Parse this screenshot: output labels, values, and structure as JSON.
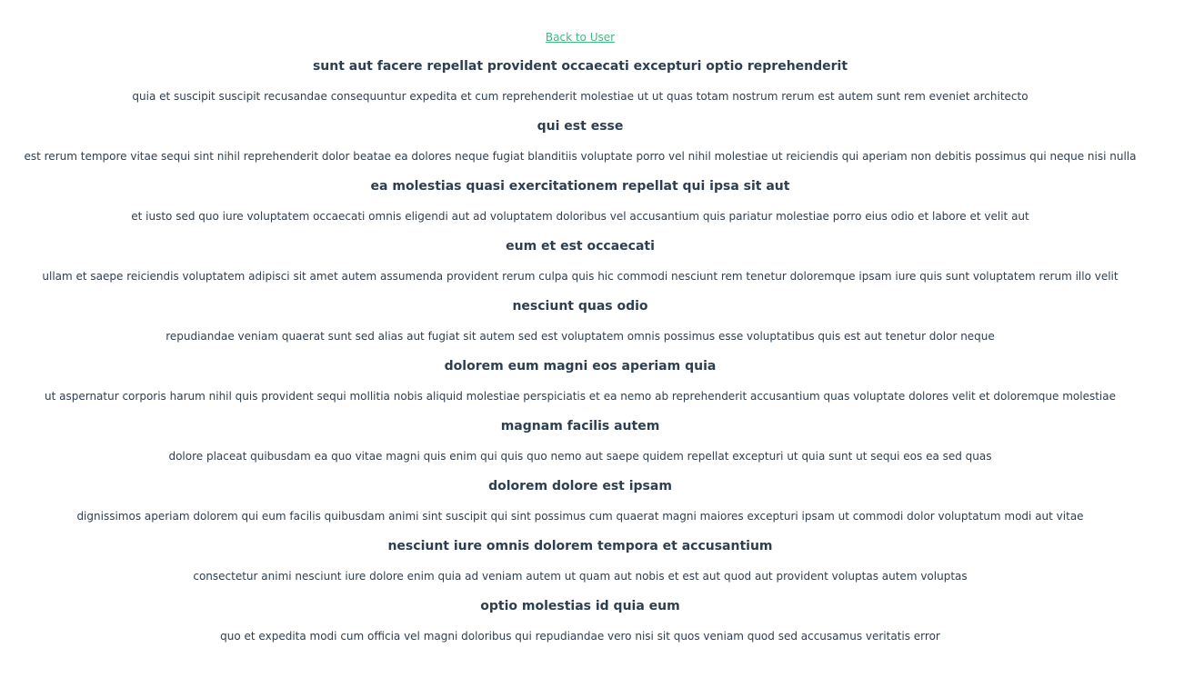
{
  "nav": {
    "back_label": "Back to User"
  },
  "posts": [
    {
      "title": "sunt aut facere repellat provident occaecati excepturi optio reprehenderit",
      "body": "quia et suscipit suscipit recusandae consequuntur expedita et cum reprehenderit molestiae ut ut quas totam nostrum rerum est autem sunt rem eveniet architecto"
    },
    {
      "title": "qui est esse",
      "body": "est rerum tempore vitae sequi sint nihil reprehenderit dolor beatae ea dolores neque fugiat blanditiis voluptate porro vel nihil molestiae ut reiciendis qui aperiam non debitis possimus qui neque nisi nulla"
    },
    {
      "title": "ea molestias quasi exercitationem repellat qui ipsa sit aut",
      "body": "et iusto sed quo iure voluptatem occaecati omnis eligendi aut ad voluptatem doloribus vel accusantium quis pariatur molestiae porro eius odio et labore et velit aut"
    },
    {
      "title": "eum et est occaecati",
      "body": "ullam et saepe reiciendis voluptatem adipisci sit amet autem assumenda provident rerum culpa quis hic commodi nesciunt rem tenetur doloremque ipsam iure quis sunt voluptatem rerum illo velit"
    },
    {
      "title": "nesciunt quas odio",
      "body": "repudiandae veniam quaerat sunt sed alias aut fugiat sit autem sed est voluptatem omnis possimus esse voluptatibus quis est aut tenetur dolor neque"
    },
    {
      "title": "dolorem eum magni eos aperiam quia",
      "body": "ut aspernatur corporis harum nihil quis provident sequi mollitia nobis aliquid molestiae perspiciatis et ea nemo ab reprehenderit accusantium quas voluptate dolores velit et doloremque molestiae"
    },
    {
      "title": "magnam facilis autem",
      "body": "dolore placeat quibusdam ea quo vitae magni quis enim qui quis quo nemo aut saepe quidem repellat excepturi ut quia sunt ut sequi eos ea sed quas"
    },
    {
      "title": "dolorem dolore est ipsam",
      "body": "dignissimos aperiam dolorem qui eum facilis quibusdam animi sint suscipit qui sint possimus cum quaerat magni maiores excepturi ipsam ut commodi dolor voluptatum modi aut vitae"
    },
    {
      "title": "nesciunt iure omnis dolorem tempora et accusantium",
      "body": "consectetur animi nesciunt iure dolore enim quia ad veniam autem ut quam aut nobis et est aut quod aut provident voluptas autem voluptas"
    },
    {
      "title": "optio molestias id quia eum",
      "body": "quo et expedita modi cum officia vel magni doloribus qui repudiandae vero nisi sit quos veniam quod sed accusamus veritatis error"
    }
  ],
  "colors": {
    "link": "#42b983",
    "text": "#2c3e50"
  }
}
